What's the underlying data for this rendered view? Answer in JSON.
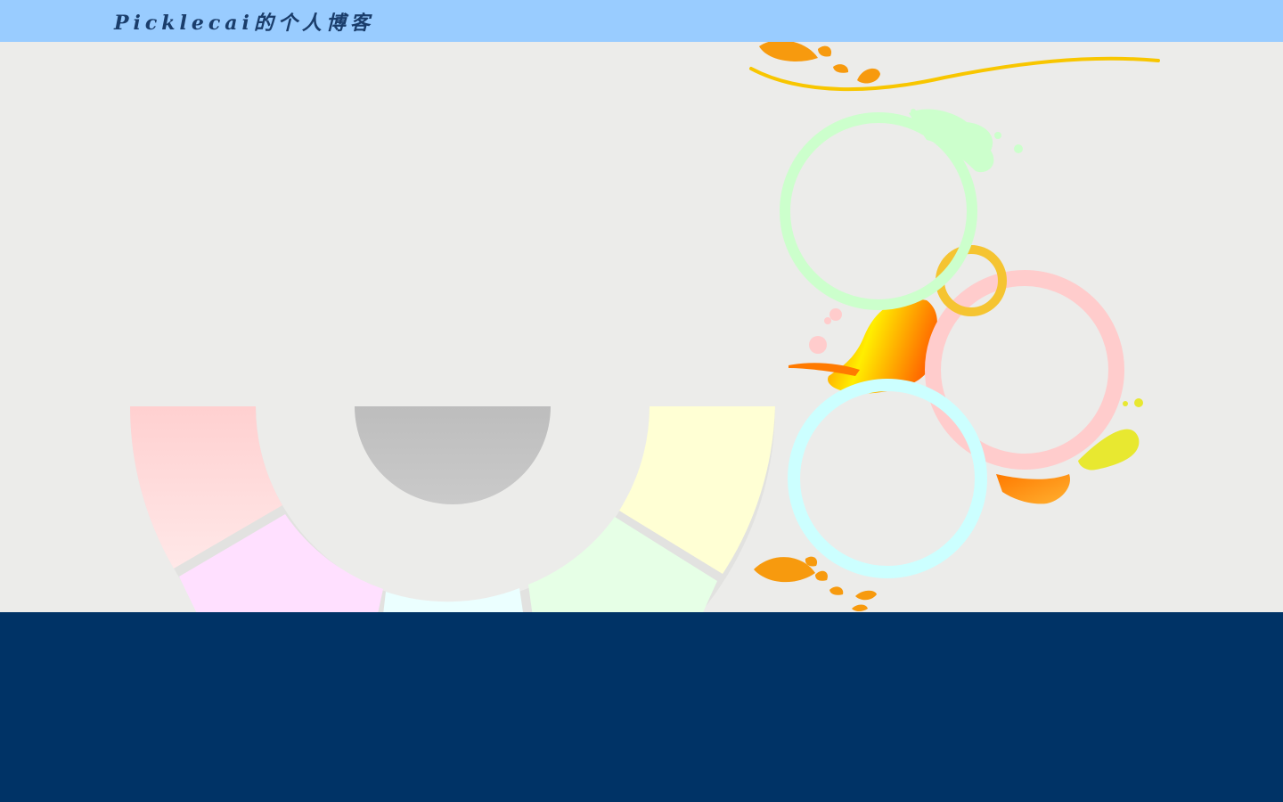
{
  "header": {
    "title": "Picklecai的个人博客",
    "background_color": "#99ccff",
    "title_color": "#1a3d6b"
  },
  "main": {
    "background_color": "#ececea",
    "color_wheel": {
      "segment_colors": [
        "#ffd2d2",
        "#ffe0ff",
        "#e9ffff",
        "#e6ffe6",
        "#ffffd6"
      ],
      "hub_color": "#c4c4c4"
    },
    "decoration": {
      "ring_colors": [
        "#ccffcc",
        "#ffcccc",
        "#ccffff",
        "#f5c431"
      ],
      "splash_colors": [
        "#ff7a00",
        "#ffe600",
        "#e8e830"
      ],
      "leaf_color": "#f79a0e",
      "swoosh_color": "#f8c600"
    }
  },
  "footer": {
    "background_color": "#003366"
  }
}
